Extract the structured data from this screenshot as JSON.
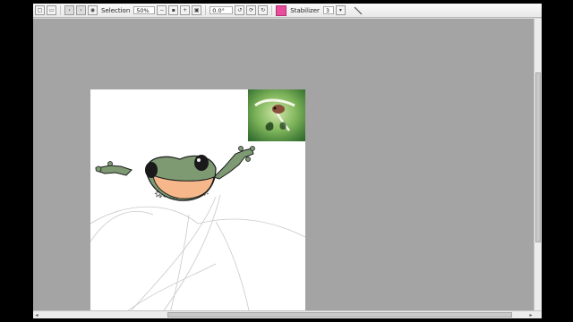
{
  "toolbar": {
    "tool_label": "Selection",
    "zoom_value": "50%",
    "rotation_value": "0.0°",
    "stabilizer_label": "Stabilizer",
    "stabilizer_value": "3"
  },
  "icons": {
    "zoom_out": "minus-icon",
    "zoom_fit": "fit-icon",
    "zoom_in": "plus-icon",
    "rotate_left": "rotate-left-icon",
    "rotate_right": "rotate-right-icon",
    "stabilizer": "stabilizer-icon",
    "pen": "pen-icon"
  },
  "colors": {
    "workarea": "#a4a4a4",
    "canvas": "#ffffff",
    "frog_skin": "#7d9a73",
    "frog_belly": "#f6b88a",
    "stabilizer_accent": "#e84c9a"
  }
}
